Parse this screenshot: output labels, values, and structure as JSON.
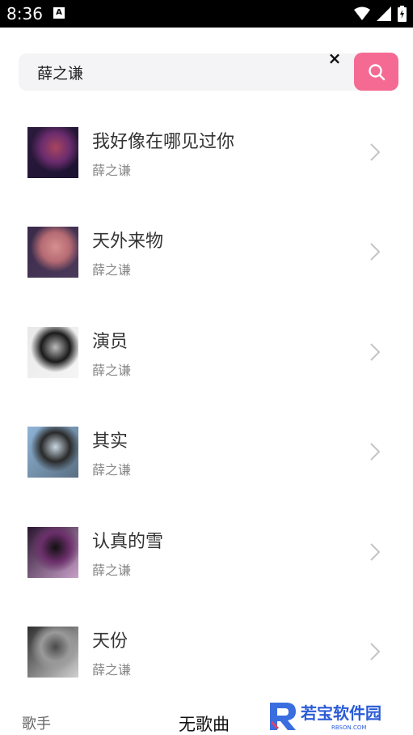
{
  "status_bar": {
    "time": "8:36",
    "notification_icon": "A"
  },
  "search": {
    "query": "薛之谦",
    "clear_label": "×"
  },
  "songs": [
    {
      "title": "我好像在哪见过你",
      "artist": "薛之谦",
      "cover_colors": [
        "#2b1a3c",
        "#6b2c6e",
        "#a8455e",
        "#1c1330"
      ]
    },
    {
      "title": "天外来物",
      "artist": "薛之谦",
      "cover_colors": [
        "#3a2a4a",
        "#b66b73",
        "#d68f8f",
        "#4c3a5a"
      ]
    },
    {
      "title": "演员",
      "artist": "薛之谦",
      "cover_colors": [
        "#e8e8e8",
        "#1a1a1a",
        "#bbbbbb",
        "#f5f5f5"
      ]
    },
    {
      "title": "其实",
      "artist": "薛之谦",
      "cover_colors": [
        "#8fb5d8",
        "#2a2a2a",
        "#c9d8e3",
        "#5a6f82"
      ]
    },
    {
      "title": "认真的雪",
      "artist": "薛之谦",
      "cover_colors": [
        "#2a1530",
        "#6b2f6a",
        "#111111",
        "#c8a0c8"
      ]
    },
    {
      "title": "天份",
      "artist": "薛之谦",
      "cover_colors": [
        "#2e2e2e",
        "#9a9a9a",
        "#4a4a4a",
        "#d0d0d0"
      ]
    }
  ],
  "bottom": {
    "tab_singer": "歌手",
    "no_songs": "无歌曲",
    "watermark_text": "若宝软件园",
    "watermark_sub": "RBSON.COM"
  },
  "colors": {
    "accent": "#f56a93",
    "search_bg": "#f4f4f6"
  }
}
